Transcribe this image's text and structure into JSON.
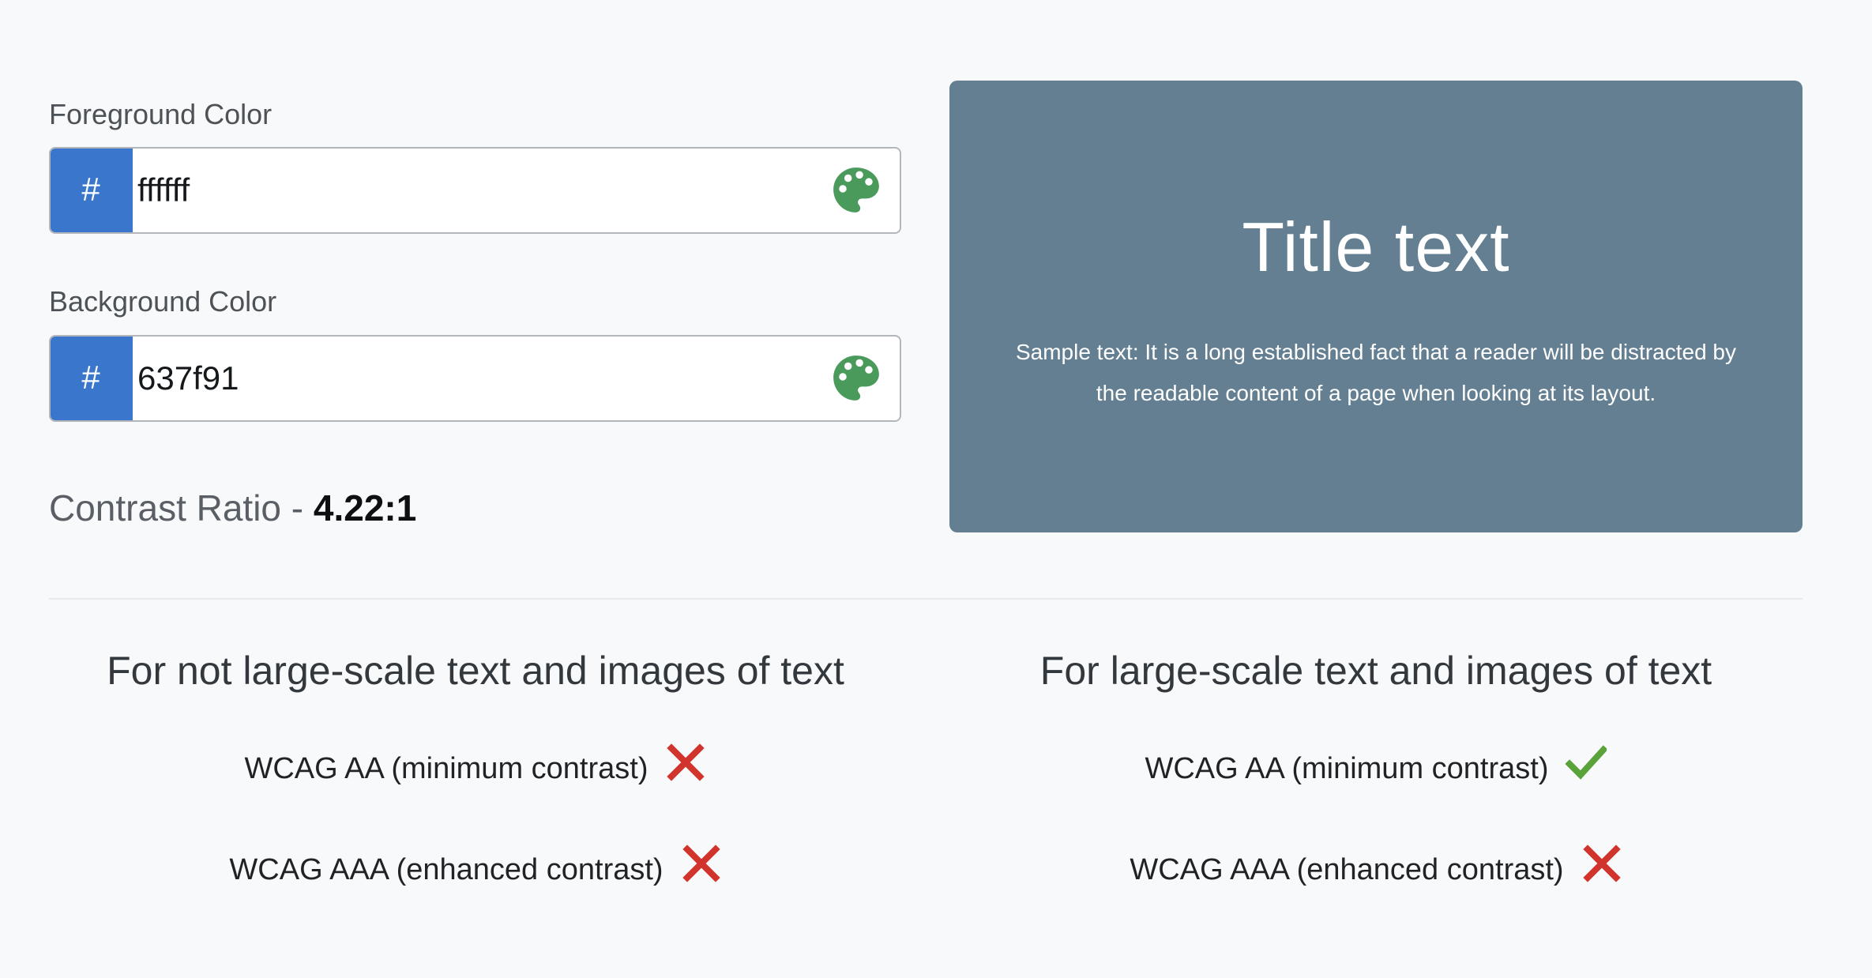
{
  "foreground": {
    "label": "Foreground Color",
    "prefix": "#",
    "value": "ffffff",
    "picker_icon": "palette-icon"
  },
  "background": {
    "label": "Background Color",
    "prefix": "#",
    "value": "637f91",
    "picker_icon": "palette-icon"
  },
  "contrast": {
    "label": "Contrast Ratio - ",
    "value": "4.22:1"
  },
  "preview": {
    "title": "Title text",
    "sample": "Sample text: It is a long established fact that a reader will be distracted by the readable content of a page when looking at its layout.",
    "background_color": "#637f91",
    "text_color": "#ffffff"
  },
  "results": {
    "normal_text": {
      "heading": "For not large-scale text and images of text",
      "aa": {
        "label": "WCAG AA (minimum contrast)",
        "pass": false,
        "icon": "cross-icon"
      },
      "aaa": {
        "label": "WCAG AAA (enhanced contrast)",
        "pass": false,
        "icon": "cross-icon"
      }
    },
    "large_text": {
      "heading": "For large-scale text and images of text",
      "aa": {
        "label": "WCAG AA (minimum contrast)",
        "pass": true,
        "icon": "check-icon"
      },
      "aaa": {
        "label": "WCAG AAA (enhanced contrast)",
        "pass": false,
        "icon": "cross-icon"
      }
    }
  },
  "colors": {
    "accent": "#3a76cc",
    "palette": "#4a9a5c",
    "pass": "#5aa33a",
    "fail": "#d0342c"
  }
}
